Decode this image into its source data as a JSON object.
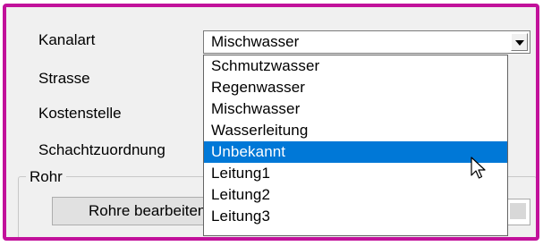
{
  "form": {
    "kanalart_label": "Kanalart",
    "strasse_label": "Strasse",
    "kostenstelle_label": "Kostenstelle",
    "schachtzuordnung_label": "Schachtzuordnung"
  },
  "combo": {
    "selected_value": "Mischwasser"
  },
  "dropdown": {
    "options": [
      "Schmutzwasser",
      "Regenwasser",
      "Mischwasser",
      "Wasserleitung",
      "Unbekannt",
      "Leitung1",
      "Leitung2",
      "Leitung3"
    ],
    "highlighted_option": "Unbekannt"
  },
  "rohr_group": {
    "title": "Rohr",
    "edit_button_label": "Rohre bearbeiten"
  },
  "colors": {
    "frame_border": "#c2119b",
    "selection": "#0078d7",
    "dialog_bg": "#f0f0f0"
  },
  "icons": {
    "combo_arrow": "chevron-down-icon",
    "cursor": "mouse-pointer-icon"
  }
}
